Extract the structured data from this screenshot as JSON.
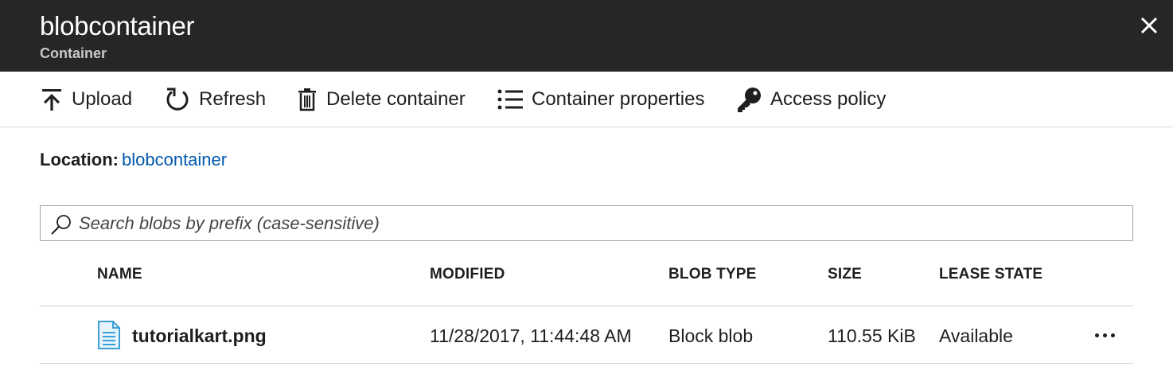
{
  "header": {
    "title": "blobcontainer",
    "subtitle": "Container",
    "close_icon": "close-icon"
  },
  "toolbar": {
    "items": [
      {
        "label": "Upload",
        "icon": "upload-icon"
      },
      {
        "label": "Refresh",
        "icon": "refresh-icon"
      },
      {
        "label": "Delete container",
        "icon": "trash-icon"
      },
      {
        "label": "Container properties",
        "icon": "list-icon"
      },
      {
        "label": "Access policy",
        "icon": "key-icon"
      }
    ]
  },
  "location": {
    "label": "Location:",
    "value": "blobcontainer"
  },
  "search": {
    "placeholder": "Search blobs by prefix (case-sensitive)",
    "value": ""
  },
  "table": {
    "columns": [
      "NAME",
      "MODIFIED",
      "BLOB TYPE",
      "SIZE",
      "LEASE STATE"
    ],
    "rows": [
      {
        "name": "tutorialkart.png",
        "modified": "11/28/2017, 11:44:48 AM",
        "blob_type": "Block blob",
        "size": "110.55 KiB",
        "lease_state": "Available",
        "icon": "file-icon"
      }
    ]
  },
  "colors": {
    "header_bg": "#262626",
    "link": "#0058ad",
    "file_icon": "#3a9fd6"
  }
}
